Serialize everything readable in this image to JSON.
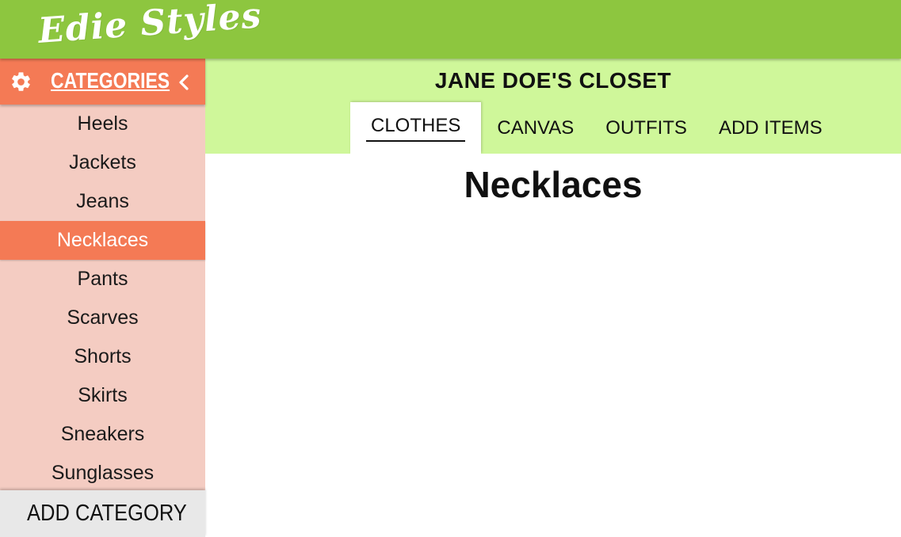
{
  "app": {
    "logo_text": "Edie Styles"
  },
  "sidebar": {
    "title": "CATEGORIES",
    "items": [
      {
        "label": "Heels"
      },
      {
        "label": "Jackets"
      },
      {
        "label": "Jeans"
      },
      {
        "label": "Necklaces",
        "active": true
      },
      {
        "label": "Pants"
      },
      {
        "label": "Scarves"
      },
      {
        "label": "Shorts"
      },
      {
        "label": "Skirts"
      },
      {
        "label": "Sneakers"
      },
      {
        "label": "Sunglasses"
      }
    ],
    "add_label": "ADD CATEGORY"
  },
  "closet": {
    "title": "JANE DOE'S CLOSET",
    "tabs": [
      {
        "label": "CLOTHES",
        "active": true
      },
      {
        "label": "CANVAS"
      },
      {
        "label": "OUTFITS"
      },
      {
        "label": "ADD ITEMS"
      }
    ]
  },
  "main": {
    "heading": "Necklaces"
  },
  "colors": {
    "header_green": "#8dc63f",
    "closet_green": "#cff79a",
    "accent_orange": "#f47a55",
    "sidebar_pink": "#f4ccc2",
    "footer_gray": "#e8e8e8"
  },
  "icons": {
    "settings": "gear-icon",
    "collapse": "chevron-left-icon",
    "add": "plus-icon"
  }
}
